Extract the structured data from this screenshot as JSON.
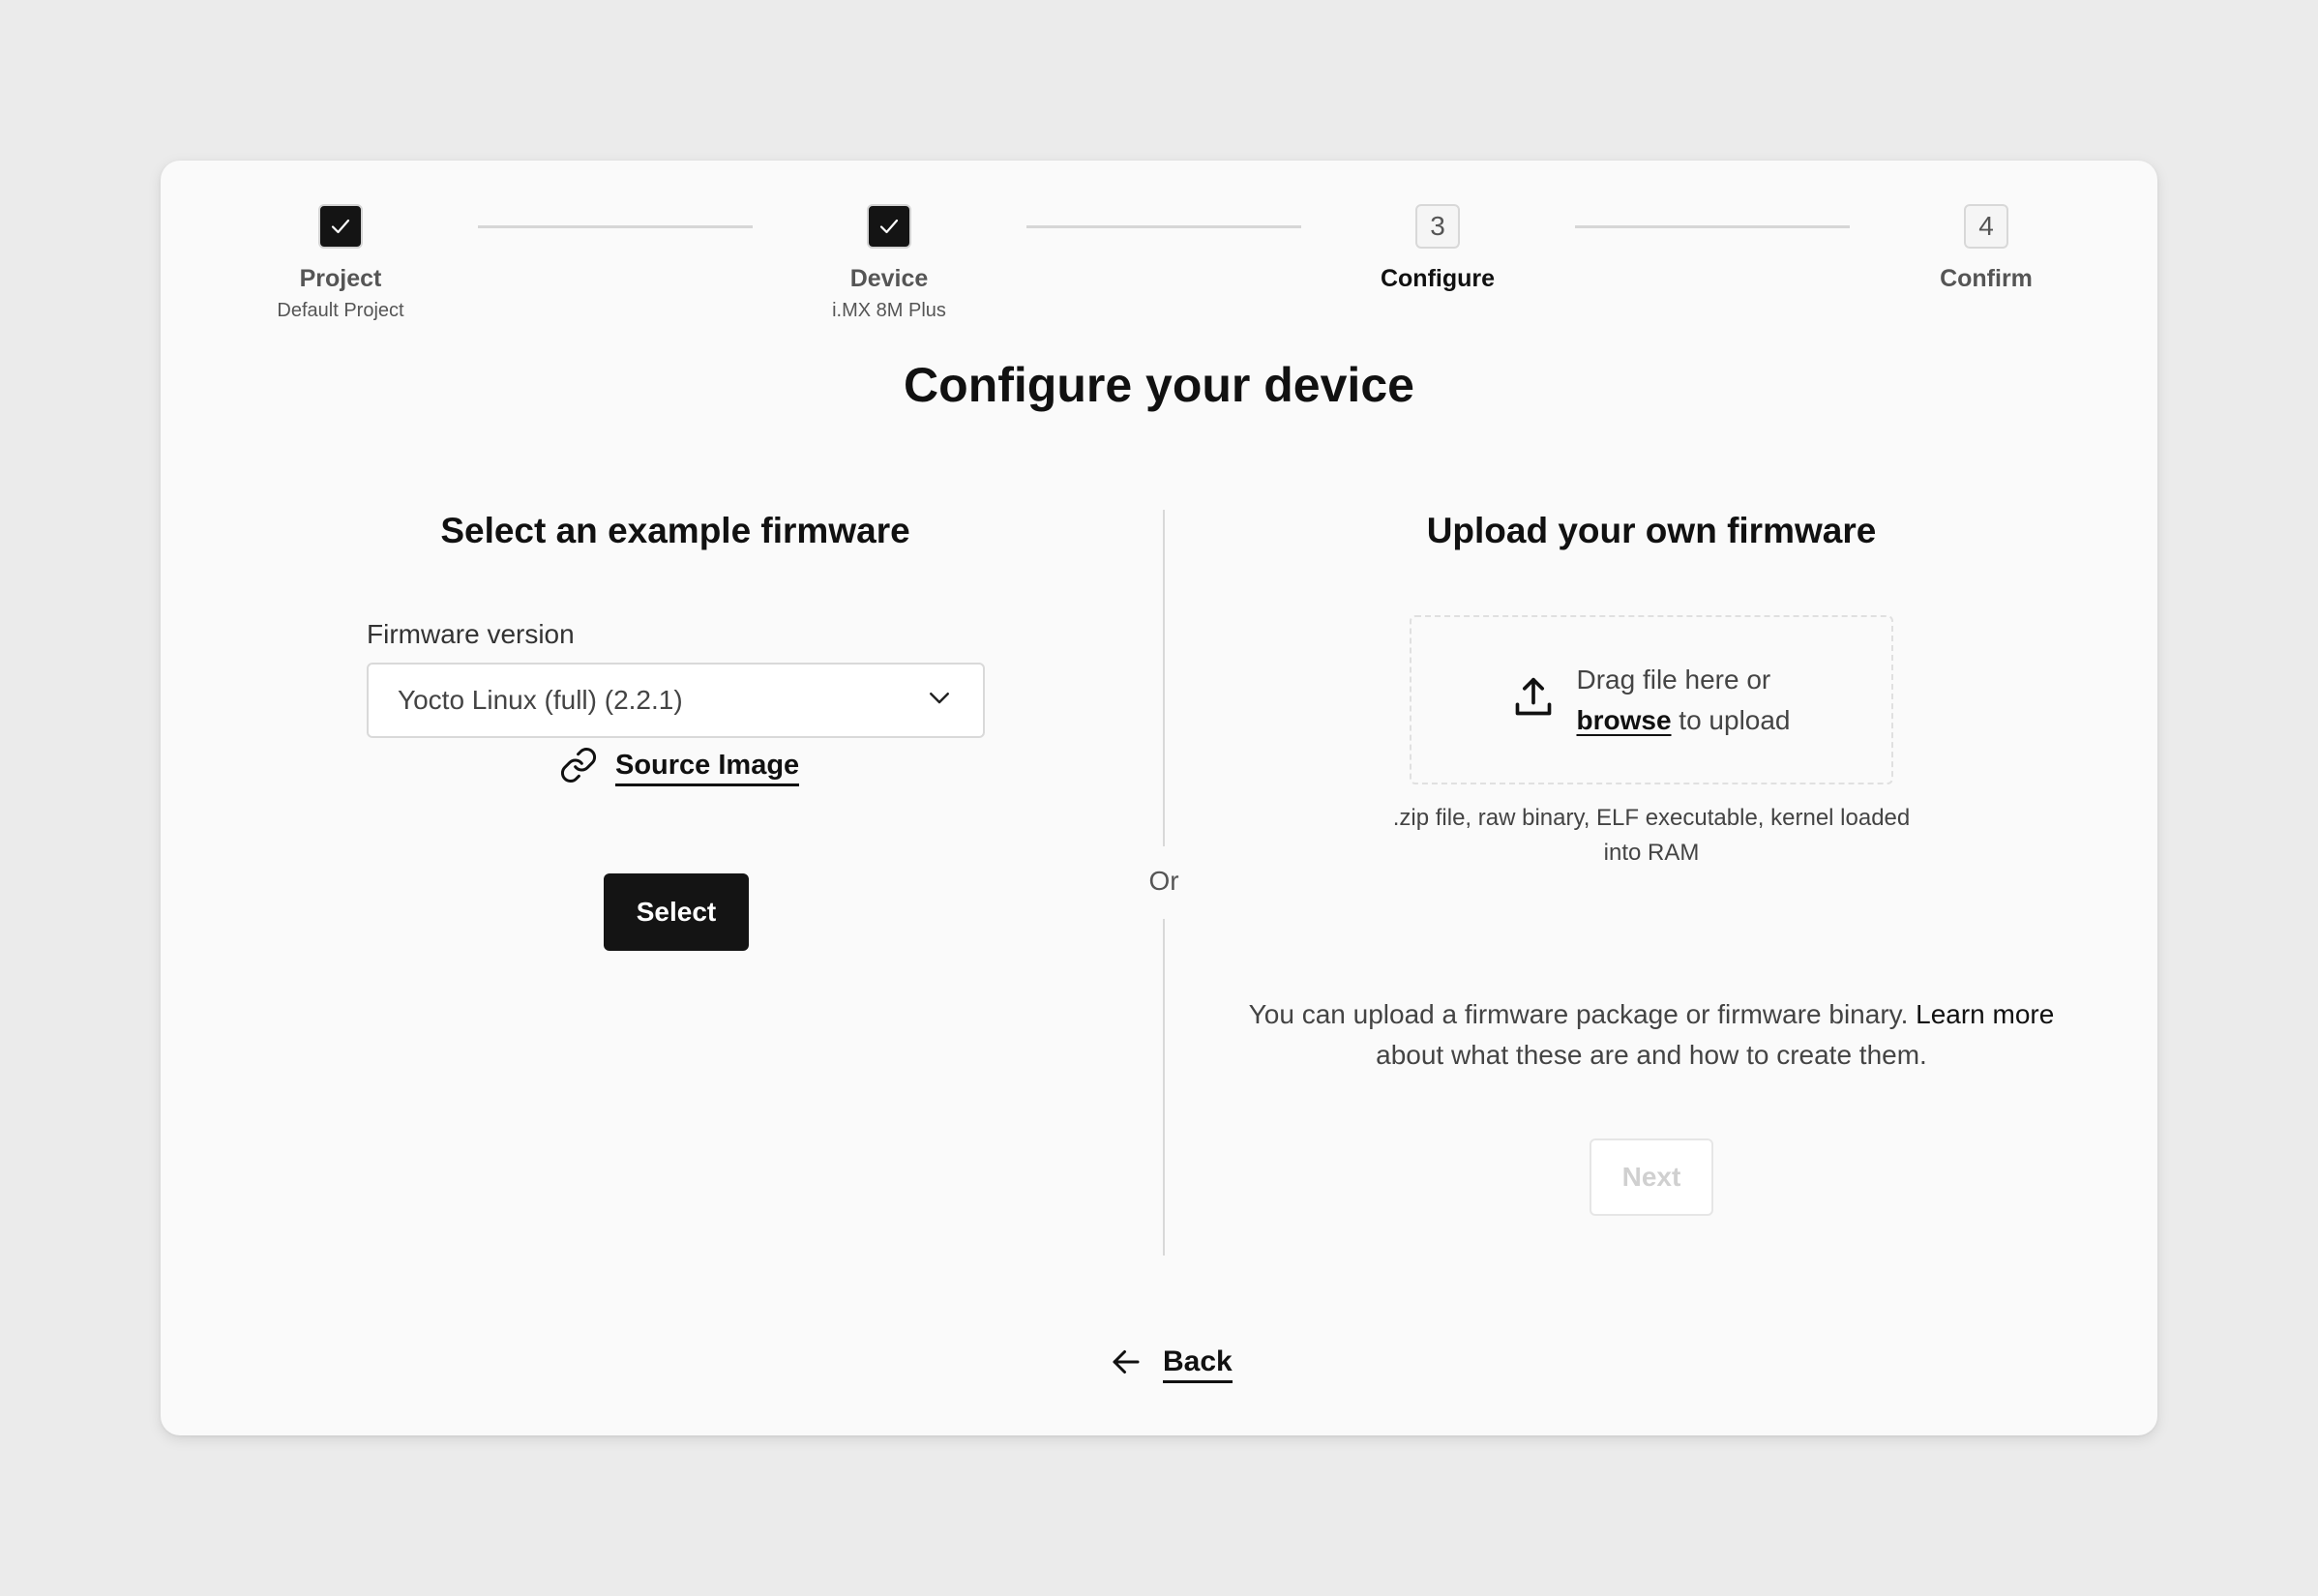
{
  "stepper": {
    "steps": [
      {
        "number": "1",
        "label": "Project",
        "sublabel": "Default Project",
        "state": "completed"
      },
      {
        "number": "2",
        "label": "Device",
        "sublabel": "i.MX 8M Plus",
        "state": "completed"
      },
      {
        "number": "3",
        "label": "Configure",
        "sublabel": "",
        "state": "current"
      },
      {
        "number": "4",
        "label": "Confirm",
        "sublabel": "",
        "state": "upcoming"
      }
    ]
  },
  "page": {
    "title": "Configure your device",
    "divider_text": "Or"
  },
  "example_firmware": {
    "heading": "Select an example firmware",
    "field_label": "Firmware version",
    "selected_value": "Yocto Linux (full) (2.2.1)",
    "source_link_label": "Source Image",
    "select_button_label": "Select"
  },
  "upload_firmware": {
    "heading": "Upload your own firmware",
    "dropzone_line1": "Drag file here or",
    "dropzone_browse": "browse",
    "dropzone_line2_rest": " to upload",
    "hint": ".zip file, raw binary, ELF executable, kernel loaded into RAM",
    "help_text": "You can upload a firmware package or firmware binary. ",
    "help_link": "Learn more",
    "help_text_after": " about what these are and how to create them.",
    "next_button_label": "Next",
    "next_disabled": true
  },
  "footer": {
    "back_label": "Back"
  },
  "colors": {
    "background": "#ebebeb",
    "card": "#fafafa",
    "primary": "#141414",
    "disabled_text": "#d0d0d0"
  }
}
